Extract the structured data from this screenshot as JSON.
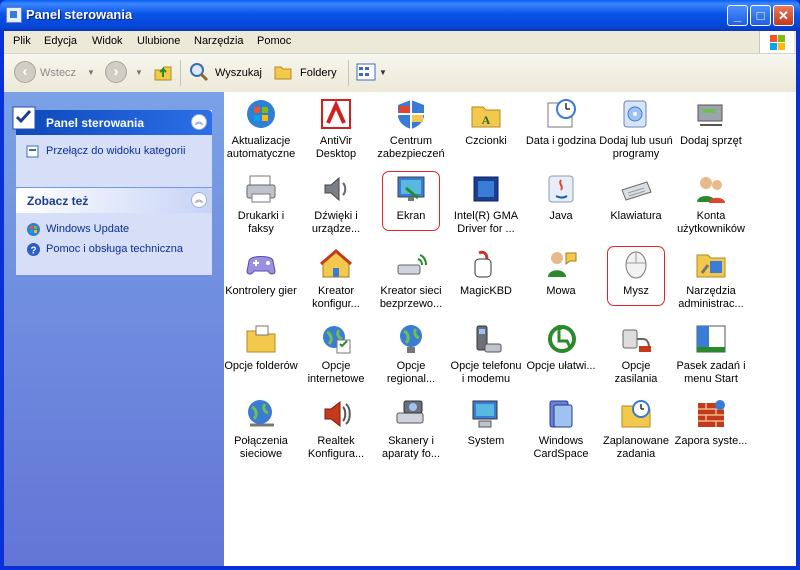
{
  "window": {
    "title": "Panel sterowania"
  },
  "menu": [
    "Plik",
    "Edycja",
    "Widok",
    "Ulubione",
    "Narzędzia",
    "Pomoc"
  ],
  "toolbar": {
    "back": "Wstecz",
    "search": "Wyszukaj",
    "folders": "Foldery"
  },
  "sidebar": {
    "panel1": {
      "title": "Panel sterowania",
      "link": "Przełącz do widoku kategorii"
    },
    "panel2": {
      "title": "Zobacz też",
      "links": [
        "Windows Update",
        "Pomoc i obsługa techniczna"
      ]
    }
  },
  "items": [
    {
      "label": "Aktualizacje automatyczne",
      "icon": "windows-shield-icon"
    },
    {
      "label": "AntiVir Desktop",
      "icon": "antivir-umbrella-icon"
    },
    {
      "label": "Centrum zabezpieczeń",
      "icon": "security-shield-icon"
    },
    {
      "label": "Czcionki",
      "icon": "fonts-folder-icon"
    },
    {
      "label": "Data i godzina",
      "icon": "clock-icon"
    },
    {
      "label": "Dodaj lub usuń programy",
      "icon": "add-remove-programs-icon"
    },
    {
      "label": "Dodaj sprzęt",
      "icon": "add-hardware-icon"
    },
    {
      "label": "Drukarki i faksy",
      "icon": "printer-icon"
    },
    {
      "label": "Dźwięki i urządze...",
      "icon": "speaker-icon"
    },
    {
      "label": "Ekran",
      "icon": "display-icon"
    },
    {
      "label": "Intel(R) GMA Driver for ...",
      "icon": "intel-display-icon"
    },
    {
      "label": "Java",
      "icon": "java-icon"
    },
    {
      "label": "Klawiatura",
      "icon": "keyboard-icon"
    },
    {
      "label": "Konta użytkowników",
      "icon": "user-accounts-icon"
    },
    {
      "label": "Kontrolery gier",
      "icon": "game-controller-icon"
    },
    {
      "label": "Kreator konfigur...",
      "icon": "house-network-icon"
    },
    {
      "label": "Kreator sieci bezprzewo...",
      "icon": "wireless-network-icon"
    },
    {
      "label": "MagicKBD",
      "icon": "magickbd-icon"
    },
    {
      "label": "Mowa",
      "icon": "speech-icon"
    },
    {
      "label": "Mysz",
      "icon": "mouse-icon"
    },
    {
      "label": "Narzędzia administrac...",
      "icon": "admin-tools-icon"
    },
    {
      "label": "Opcje folderów",
      "icon": "folder-options-icon"
    },
    {
      "label": "Opcje internetowe",
      "icon": "internet-options-icon"
    },
    {
      "label": "Opcje regional...",
      "icon": "regional-globe-icon"
    },
    {
      "label": "Opcje telefonu i modemu",
      "icon": "phone-modem-icon"
    },
    {
      "label": "Opcje ułatwi...",
      "icon": "accessibility-icon"
    },
    {
      "label": "Opcje zasilania",
      "icon": "power-plug-icon"
    },
    {
      "label": "Pasek zadań i menu Start",
      "icon": "taskbar-icon"
    },
    {
      "label": "Połączenia sieciowe",
      "icon": "network-connections-icon"
    },
    {
      "label": "Realtek Konfigura...",
      "icon": "realtek-audio-icon"
    },
    {
      "label": "Skanery i aparaty fo...",
      "icon": "scanner-camera-icon"
    },
    {
      "label": "System",
      "icon": "system-computer-icon"
    },
    {
      "label": "Windows CardSpace",
      "icon": "cardspace-icon"
    },
    {
      "label": "Zaplanowane zadania",
      "icon": "scheduled-tasks-icon"
    },
    {
      "label": "Zapora syste...",
      "icon": "firewall-icon"
    }
  ],
  "highlighted": [
    "Ekran",
    "Mysz"
  ],
  "colors": {
    "titlebar": "#0a54e8",
    "sidebar": "#6f8fe0",
    "highlight_ring": "#e3242b",
    "link": "#0c2f95"
  }
}
